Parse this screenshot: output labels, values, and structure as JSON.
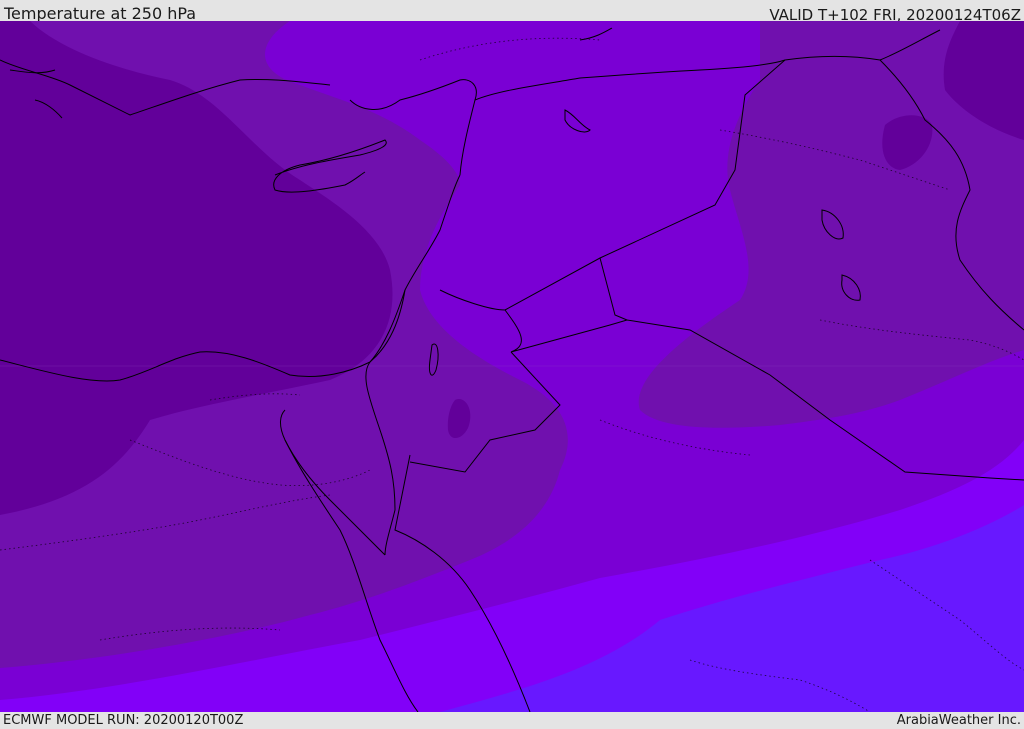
{
  "header": {
    "title": "Temperature at 250 hPa",
    "valid_time": "VALID T+102 FRI, 20200124T06Z"
  },
  "footer": {
    "model_run": "ECMWF MODEL RUN: 20200120T00Z",
    "brand": "ArabiaWeather Inc."
  },
  "map": {
    "region": "Eastern Mediterranean and Middle East",
    "colors": {
      "band_darkest": "#62009a",
      "band_dark": "#7010ae",
      "band_mid": "#7a00d4",
      "band_bright": "#8200f8",
      "band_blue": "#6818ff",
      "borders": "#000000"
    }
  }
}
